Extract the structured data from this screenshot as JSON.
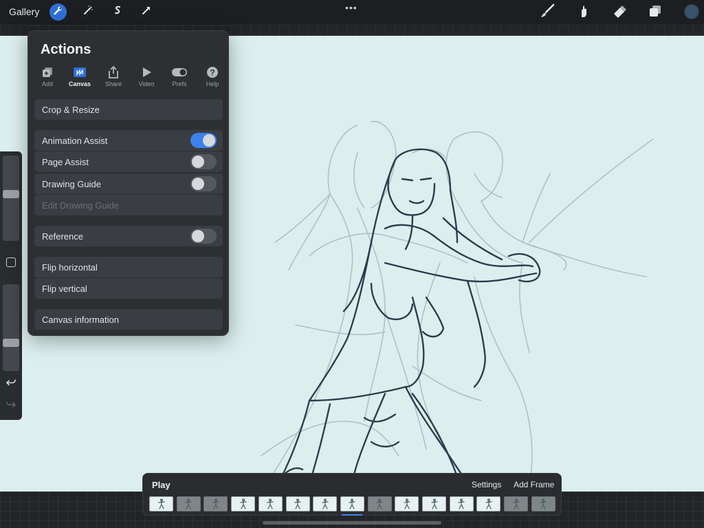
{
  "topbar": {
    "gallery_label": "Gallery",
    "more_label": "•••",
    "tools_left": [
      "wrench-icon",
      "magic-wand-icon",
      "selection-icon",
      "transform-icon"
    ],
    "tools_right": [
      "brush-icon",
      "smudge-icon",
      "eraser-icon",
      "layers-icon"
    ],
    "current_color": "#38526b",
    "accent_color": "#2f6fd6"
  },
  "actions": {
    "title": "Actions",
    "tabs": [
      {
        "label": "Add",
        "icon": "add-icon",
        "active": false
      },
      {
        "label": "Canvas",
        "icon": "canvas-icon",
        "active": true
      },
      {
        "label": "Share",
        "icon": "share-icon",
        "active": false
      },
      {
        "label": "Video",
        "icon": "video-icon",
        "active": false
      },
      {
        "label": "Prefs",
        "icon": "prefs-icon",
        "active": false
      },
      {
        "label": "Help",
        "icon": "help-icon",
        "active": false
      }
    ],
    "rows": {
      "crop_resize": "Crop & Resize",
      "animation_assist": {
        "label": "Animation Assist",
        "on": true
      },
      "page_assist": {
        "label": "Page Assist",
        "on": false
      },
      "drawing_guide": {
        "label": "Drawing Guide",
        "on": false
      },
      "edit_drawing_guide": "Edit Drawing Guide",
      "reference": {
        "label": "Reference",
        "on": false
      },
      "flip_horizontal": "Flip horizontal",
      "flip_vertical": "Flip vertical",
      "canvas_information": "Canvas information"
    }
  },
  "sidebar": {
    "brush_size_level": 0.45,
    "opacity_level": 0.35,
    "icons": [
      "modify-square-icon",
      "undo-icon",
      "redo-icon"
    ]
  },
  "animation": {
    "play_label": "Play",
    "settings_label": "Settings",
    "add_frame_label": "Add Frame",
    "frame_count": 15,
    "selected_frame": 8,
    "dim_frames": [
      2,
      3,
      9,
      14,
      15
    ]
  }
}
